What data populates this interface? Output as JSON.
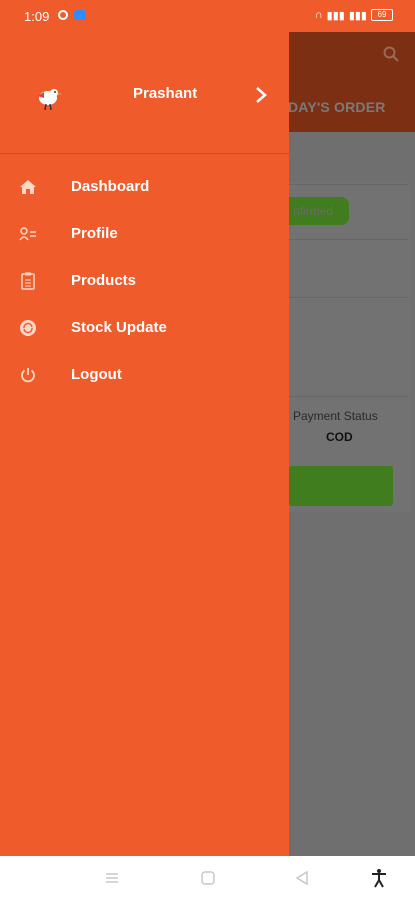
{
  "status": {
    "time": "1:09",
    "battery": "69"
  },
  "background": {
    "tab_label": "DAY'S ORDER",
    "badge_text": "nfirmed",
    "payment_status_label": "Payment Status",
    "payment_status_value": "COD"
  },
  "drawer": {
    "user_name": "Prashant",
    "menu": [
      {
        "label": "Dashboard",
        "icon": "home-icon"
      },
      {
        "label": "Profile",
        "icon": "profile-icon"
      },
      {
        "label": "Products",
        "icon": "products-icon"
      },
      {
        "label": "Stock Update",
        "icon": "stock-update-icon"
      },
      {
        "label": "Logout",
        "icon": "power-icon"
      }
    ]
  },
  "colors": {
    "accent": "#ef5b2b",
    "scrim": "#6f6f6f",
    "success": "#3f7d1e"
  }
}
